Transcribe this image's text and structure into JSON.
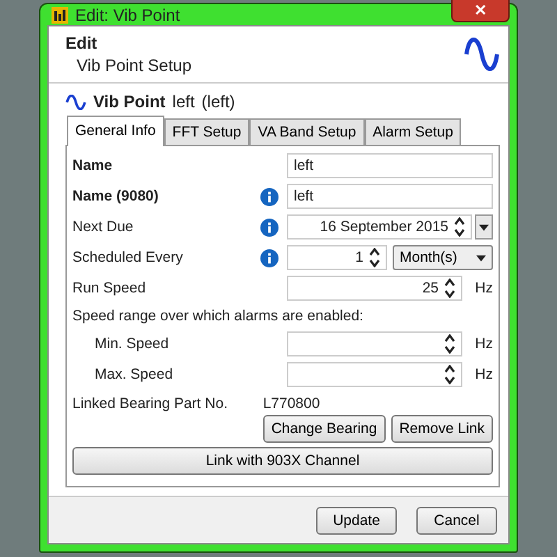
{
  "window": {
    "title": "Edit: Vib Point",
    "close": "✕"
  },
  "header": {
    "title": "Edit",
    "subtitle": "Vib Point Setup"
  },
  "point": {
    "label": "Vib Point",
    "name": "left",
    "detail": "(left)"
  },
  "tabs": [
    {
      "label": "General Info",
      "selected": true
    },
    {
      "label": "FFT Setup",
      "selected": false
    },
    {
      "label": "VA Band Setup",
      "selected": false
    },
    {
      "label": "Alarm Setup",
      "selected": false
    }
  ],
  "rows": [
    {
      "kind": "text",
      "label": "Name",
      "bold": true,
      "info": false,
      "value": "left"
    },
    {
      "kind": "text",
      "label": "Name (9080)",
      "bold": true,
      "info": true,
      "value": "left"
    },
    {
      "kind": "date",
      "label": "Next Due",
      "bold": false,
      "info": true,
      "value": "16 September 2015"
    },
    {
      "kind": "count",
      "label": "Scheduled Every",
      "bold": false,
      "info": true,
      "value": "1",
      "unit": "Month(s)"
    },
    {
      "kind": "speed",
      "label": "Run Speed",
      "bold": false,
      "info": false,
      "value": "25",
      "unit": "Hz"
    }
  ],
  "speed_range": {
    "caption": "Speed range over which alarms are enabled:",
    "rows": [
      {
        "label": "Min. Speed",
        "unit": "Hz"
      },
      {
        "label": "Max. Speed",
        "unit": "Hz"
      }
    ]
  },
  "bearing": {
    "label": "Linked Bearing Part No.",
    "value": "L770800",
    "buttons": [
      "Change Bearing",
      "Remove Link"
    ]
  },
  "link_button": "Link with 903X Channel",
  "footer_buttons": [
    "Update",
    "Cancel"
  ]
}
